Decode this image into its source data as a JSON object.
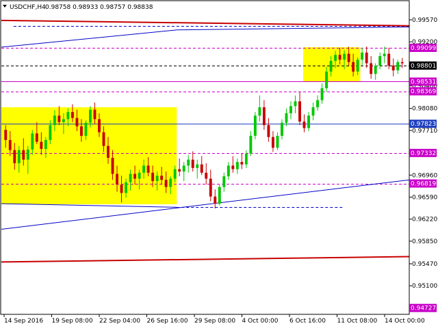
{
  "header": {
    "symbol": "USDCHF,H4",
    "quote": "0.98758 0.98933 0.98757 0.98838"
  },
  "chart_data": {
    "type": "candlestick",
    "symbol": "USDCHF",
    "timeframe": "H4",
    "ohlc_last": {
      "open": 0.98758,
      "high": 0.98933,
      "low": 0.98757,
      "close": 0.98838
    },
    "ylim": [
      0.9462,
      0.9988
    ],
    "y_ticks": [
      0.9957,
      0.992,
      0.98801,
      0.9846,
      0.9808,
      0.9771,
      0.97332,
      0.9696,
      0.9659,
      0.9622,
      0.9585,
      0.9547,
      0.951,
      0.94727
    ],
    "x_ticks": [
      "14 Sep 2016",
      "19 Sep 08:00",
      "22 Sep 04:00",
      "26 Sep 16:00",
      "29 Sep 08:00",
      "4 Oct 00:00",
      "6 Oct 16:00",
      "11 Oct 08:00",
      "14 Oct 00:00"
    ],
    "price_tags": [
      {
        "label": "0.99099",
        "value": 0.99099,
        "color": "#c800c8"
      },
      {
        "label": "0.98801",
        "value": 0.98801,
        "color": "#000000"
      },
      {
        "label": "0.98531",
        "value": 0.98531,
        "color": "#c800c8"
      },
      {
        "label": "0.98369",
        "value": 0.98369,
        "color": "#c800c8"
      },
      {
        "label": "0.97823",
        "value": 0.97823,
        "color": "#2040c0"
      },
      {
        "label": "0.97332",
        "value": 0.97332,
        "color": "#c800c8"
      },
      {
        "label": "0.96819",
        "value": 0.96819,
        "color": "#c800c8"
      },
      {
        "label": "0.94727",
        "value": 0.94727,
        "color": "#c800c8"
      }
    ],
    "rectangles": [
      {
        "t0": 0,
        "t1": 86,
        "top": 0.981,
        "bottom": 0.9647,
        "color": "#ffff00"
      },
      {
        "t0": 148,
        "t1": 176,
        "top": 0.9911,
        "bottom": 0.9853,
        "color": "#ffff00"
      }
    ],
    "horizontal_lines": [
      {
        "value": 0.9947,
        "color": "#0000c8",
        "style": "dashed",
        "t0": 6,
        "t1": 200
      },
      {
        "value": 0.99099,
        "color": "#c800c8",
        "style": "dashed",
        "t0": 0,
        "t1": 200
      },
      {
        "value": 0.98801,
        "color": "#000000",
        "style": "dashed",
        "t0": 0,
        "t1": 200
      },
      {
        "value": 0.98531,
        "color": "#c800c8",
        "style": "solid",
        "t0": 0,
        "t1": 200
      },
      {
        "value": 0.98369,
        "color": "#c800c8",
        "style": "dashed",
        "t0": 0,
        "t1": 200
      },
      {
        "value": 0.97823,
        "color": "#2040c0",
        "style": "solid",
        "t0": 0,
        "t1": 200
      },
      {
        "value": 0.97332,
        "color": "#c800c8",
        "style": "dashed",
        "t0": 0,
        "t1": 200
      },
      {
        "value": 0.96819,
        "color": "#c800c8",
        "style": "dashed",
        "t0": 0,
        "t1": 200
      },
      {
        "value": 0.9642,
        "color": "#0000c8",
        "style": "dashed",
        "t0": 86,
        "t1": 168
      }
    ],
    "trend_lines": [
      {
        "t0": 0,
        "v0": 0.9956,
        "t1": 200,
        "v1": 0.9947,
        "color": "#c80000",
        "width": 2
      },
      {
        "t0": 0,
        "v0": 0.955,
        "t1": 200,
        "v1": 0.9559,
        "color": "#c80000",
        "width": 2
      },
      {
        "t0": 0,
        "v0": 0.9911,
        "t1": 86,
        "v1": 0.994,
        "color": "#0000c8",
        "width": 1
      },
      {
        "t0": 86,
        "v0": 0.994,
        "t1": 200,
        "v1": 0.9945,
        "color": "#0000c8",
        "width": 1
      },
      {
        "t0": 0,
        "v0": 0.9605,
        "t1": 200,
        "v1": 0.9688,
        "color": "#0000c8",
        "width": 1
      },
      {
        "t0": 0,
        "v0": 0.9648,
        "t1": 86,
        "v1": 0.9642,
        "color": "#0000c8",
        "width": 1
      }
    ],
    "series": [
      {
        "name": "",
        "ohlc": [
          [
            0.9772,
            0.978,
            0.9742,
            0.9755
          ],
          [
            0.9755,
            0.977,
            0.9728,
            0.9738
          ],
          [
            0.9738,
            0.975,
            0.9705,
            0.9716
          ],
          [
            0.9716,
            0.9745,
            0.97,
            0.9738
          ],
          [
            0.9738,
            0.9758,
            0.9712,
            0.9722
          ],
          [
            0.9722,
            0.9745,
            0.9698,
            0.9739
          ],
          [
            0.9739,
            0.9772,
            0.973,
            0.9766
          ],
          [
            0.9766,
            0.9785,
            0.9748,
            0.9752
          ],
          [
            0.9752,
            0.9768,
            0.973,
            0.974
          ],
          [
            0.974,
            0.976,
            0.9725,
            0.9755
          ],
          [
            0.9755,
            0.9788,
            0.9748,
            0.978
          ],
          [
            0.978,
            0.9805,
            0.977,
            0.9796
          ],
          [
            0.9796,
            0.9812,
            0.978,
            0.9785
          ],
          [
            0.9785,
            0.98,
            0.9765,
            0.979
          ],
          [
            0.979,
            0.9808,
            0.9778,
            0.9802
          ],
          [
            0.9802,
            0.9815,
            0.9785,
            0.9792
          ],
          [
            0.9792,
            0.9806,
            0.977,
            0.9778
          ],
          [
            0.9778,
            0.979,
            0.9752,
            0.9762
          ],
          [
            0.9762,
            0.9788,
            0.9755,
            0.9784
          ],
          [
            0.9784,
            0.9812,
            0.9776,
            0.9806
          ],
          [
            0.9806,
            0.9818,
            0.9782,
            0.979
          ],
          [
            0.979,
            0.98,
            0.976,
            0.9768
          ],
          [
            0.9768,
            0.9778,
            0.9735,
            0.9745
          ],
          [
            0.9745,
            0.976,
            0.9715,
            0.9725
          ],
          [
            0.9725,
            0.9738,
            0.9688,
            0.9698
          ],
          [
            0.9698,
            0.9712,
            0.9668,
            0.968
          ],
          [
            0.968,
            0.9695,
            0.965,
            0.9666
          ],
          [
            0.9666,
            0.969,
            0.9658,
            0.9684
          ],
          [
            0.9684,
            0.9705,
            0.967,
            0.9698
          ],
          [
            0.9698,
            0.9712,
            0.968,
            0.969
          ],
          [
            0.969,
            0.9705,
            0.9672,
            0.97
          ],
          [
            0.97,
            0.9722,
            0.969,
            0.9712
          ],
          [
            0.9712,
            0.9726,
            0.9694,
            0.97
          ],
          [
            0.97,
            0.9712,
            0.9676,
            0.9686
          ],
          [
            0.9686,
            0.9702,
            0.967,
            0.9695
          ],
          [
            0.9695,
            0.971,
            0.968,
            0.9688
          ],
          [
            0.9688,
            0.9702,
            0.9666,
            0.9676
          ],
          [
            0.9676,
            0.9694,
            0.9664,
            0.969
          ],
          [
            0.969,
            0.9712,
            0.9684,
            0.9706
          ],
          [
            0.9706,
            0.9724,
            0.9694,
            0.9702
          ],
          [
            0.9702,
            0.9718,
            0.9686,
            0.9712
          ],
          [
            0.9712,
            0.973,
            0.97,
            0.9722
          ],
          [
            0.9722,
            0.9736,
            0.9702,
            0.9708
          ],
          [
            0.9708,
            0.9722,
            0.969,
            0.9714
          ],
          [
            0.9714,
            0.9728,
            0.9696,
            0.97
          ],
          [
            0.97,
            0.9716,
            0.968,
            0.969
          ],
          [
            0.969,
            0.9705,
            0.9652,
            0.966
          ],
          [
            0.966,
            0.9672,
            0.964,
            0.9648
          ],
          [
            0.9648,
            0.968,
            0.9645,
            0.9676
          ],
          [
            0.9676,
            0.97,
            0.9668,
            0.9694
          ],
          [
            0.9694,
            0.9718,
            0.9688,
            0.9712
          ],
          [
            0.9712,
            0.9728,
            0.97,
            0.9706
          ],
          [
            0.9706,
            0.9724,
            0.9698,
            0.9718
          ],
          [
            0.9718,
            0.9732,
            0.9706,
            0.9714
          ],
          [
            0.9714,
            0.9738,
            0.9708,
            0.9732
          ],
          [
            0.9732,
            0.977,
            0.9728,
            0.9762
          ],
          [
            0.9762,
            0.9802,
            0.9756,
            0.9796
          ],
          [
            0.9796,
            0.983,
            0.9786,
            0.981
          ],
          [
            0.981,
            0.9822,
            0.9772,
            0.978
          ],
          [
            0.978,
            0.9792,
            0.9752,
            0.976
          ],
          [
            0.976,
            0.977,
            0.9735,
            0.9742
          ],
          [
            0.9742,
            0.9768,
            0.9738,
            0.9762
          ],
          [
            0.9762,
            0.979,
            0.9756,
            0.9784
          ],
          [
            0.9784,
            0.9808,
            0.9778,
            0.98
          ],
          [
            0.98,
            0.982,
            0.979,
            0.9812
          ],
          [
            0.9812,
            0.983,
            0.98,
            0.982
          ],
          [
            0.982,
            0.9836,
            0.978,
            0.9786
          ],
          [
            0.9786,
            0.9798,
            0.9768,
            0.9775
          ],
          [
            0.9775,
            0.9802,
            0.977,
            0.9796
          ],
          [
            0.9796,
            0.9818,
            0.9788,
            0.981
          ],
          [
            0.981,
            0.983,
            0.9804,
            0.9822
          ],
          [
            0.9822,
            0.985,
            0.9816,
            0.9842
          ],
          [
            0.9842,
            0.9878,
            0.9836,
            0.987
          ],
          [
            0.987,
            0.9896,
            0.9862,
            0.9888
          ],
          [
            0.9888,
            0.9905,
            0.9876,
            0.9898
          ],
          [
            0.9898,
            0.991,
            0.9882,
            0.989
          ],
          [
            0.989,
            0.9906,
            0.9874,
            0.99
          ],
          [
            0.99,
            0.9912,
            0.988,
            0.9886
          ],
          [
            0.9886,
            0.99,
            0.9862,
            0.987
          ],
          [
            0.987,
            0.9894,
            0.9864,
            0.989
          ],
          [
            0.989,
            0.991,
            0.988,
            0.9902
          ],
          [
            0.9902,
            0.9912,
            0.9876,
            0.9884
          ],
          [
            0.9884,
            0.9896,
            0.9858,
            0.9866
          ],
          [
            0.9866,
            0.9884,
            0.9856,
            0.988
          ],
          [
            0.988,
            0.9902,
            0.9874,
            0.9896
          ],
          [
            0.9896,
            0.9912,
            0.9884,
            0.99
          ],
          [
            0.99,
            0.991,
            0.9874,
            0.988
          ],
          [
            0.988,
            0.9892,
            0.9862,
            0.9872
          ],
          [
            0.9872,
            0.989,
            0.9866,
            0.9886
          ],
          [
            0.9886,
            0.9893,
            0.9876,
            0.9884
          ]
        ]
      }
    ]
  }
}
